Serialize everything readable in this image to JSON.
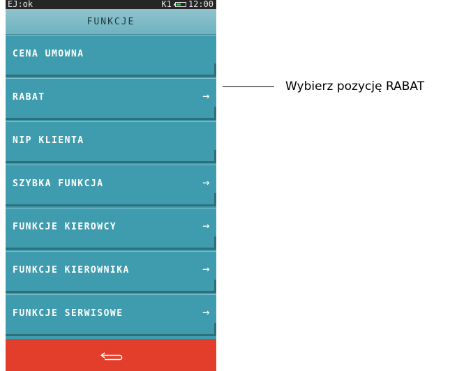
{
  "status_bar": {
    "left": "EJ:ok",
    "right_label": "K1",
    "time": "12:00",
    "battery_level": 0.55,
    "battery_color": "#39c14a"
  },
  "header": {
    "title": "FUNKCJE"
  },
  "menu": {
    "items": [
      {
        "label": "CENA UMOWNA",
        "arrow": ""
      },
      {
        "label": "RABAT",
        "arrow": "→"
      },
      {
        "label": "NIP KLIENTA",
        "arrow": ""
      },
      {
        "label": "SZYBKA FUNKCJA",
        "arrow": "→"
      },
      {
        "label": "FUNKCJE KIEROWCY",
        "arrow": "→"
      },
      {
        "label": "FUNKCJE KIEROWNIKA",
        "arrow": "→"
      },
      {
        "label": "FUNKCJE SERWISOWE",
        "arrow": "→"
      }
    ]
  },
  "back_bar": {
    "icon": "back-arrow-icon",
    "color": "#e33e2b"
  },
  "callout": {
    "text": "Wybierz pozycję RABAT"
  },
  "colors": {
    "menu_bg": "#3f9cae",
    "header_bg": "#7ab9c6",
    "status_bg": "#262626"
  }
}
